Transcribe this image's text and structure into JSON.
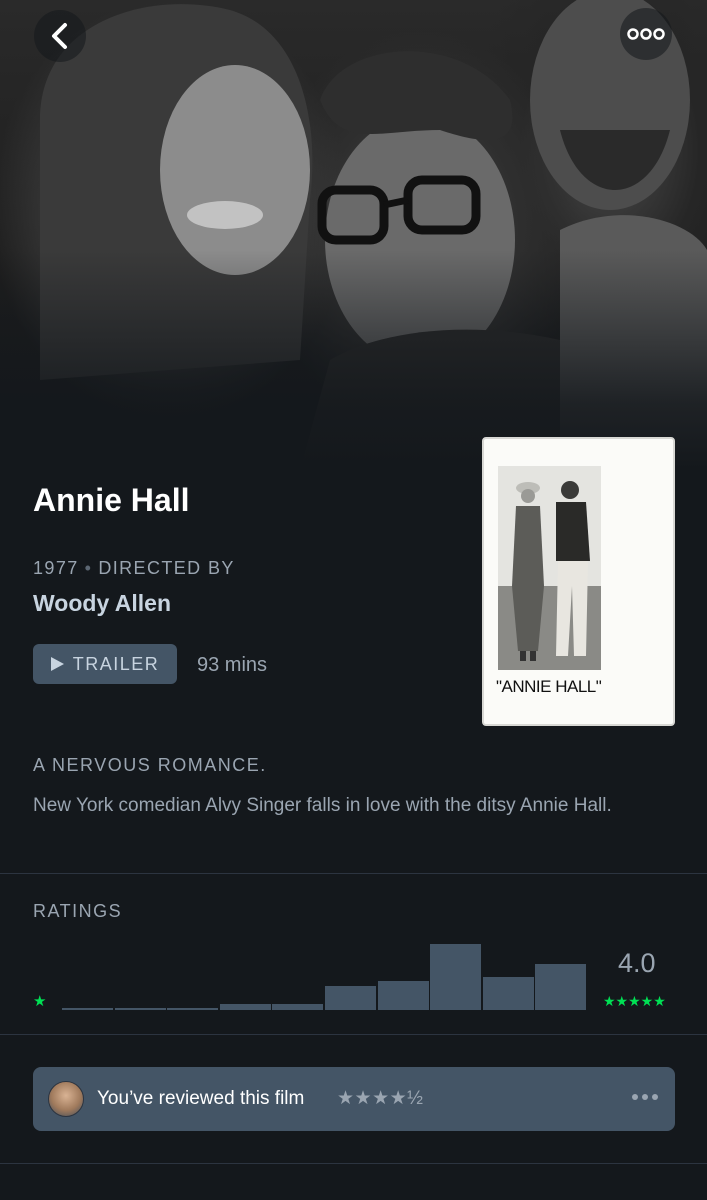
{
  "film": {
    "title": "Annie Hall",
    "year": "1977",
    "directed_by_label": "DIRECTED BY",
    "director": "Woody Allen",
    "trailer_label": "TRAILER",
    "runtime": "93 mins",
    "poster_title": "\"ANNIE HALL\"",
    "tagline": "A NERVOUS ROMANCE.",
    "synopsis": "New York comedian Alvy Singer falls in love with the ditsy Annie Hall."
  },
  "nav": {
    "back_icon": "chevron-left-icon",
    "more_icon": "more-horizontal-icon"
  },
  "ratings": {
    "label": "RATINGS",
    "low_star": "★",
    "high_stars": "★★★★★",
    "average": "4.0",
    "distribution": [
      1,
      1,
      1,
      3,
      3,
      13,
      16,
      36,
      18,
      25
    ],
    "bar_color": "#445566",
    "star_color": "#00e054"
  },
  "review": {
    "text": "You’ve reviewed this film",
    "stars": "★★★★½",
    "more_icon": "more-horizontal-icon"
  },
  "colors": {
    "background": "#14181c",
    "accent_green": "#00e054",
    "muted_text": "#9aa5b1",
    "button_bg": "#445566"
  }
}
